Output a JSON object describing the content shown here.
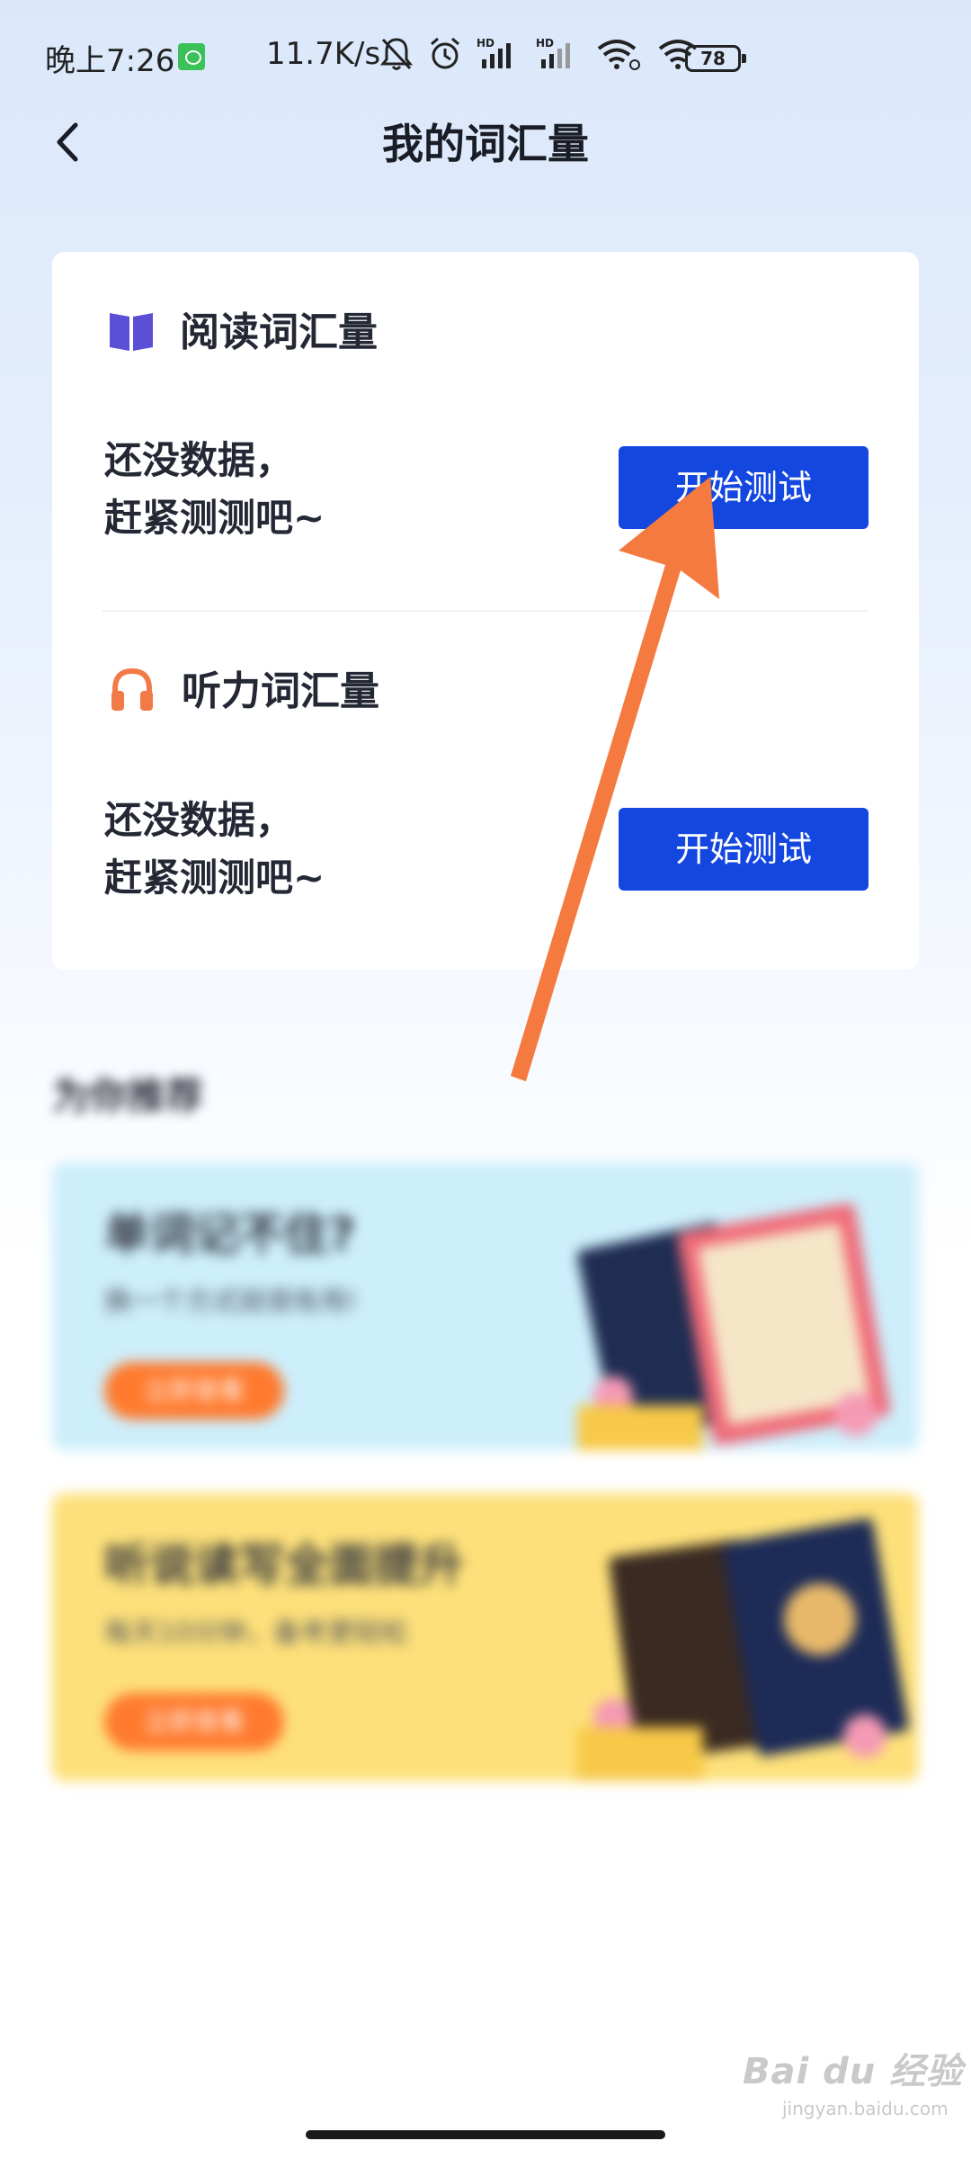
{
  "status_bar": {
    "time": "晚上7:26",
    "net_speed": "11.7K/s",
    "battery": "78",
    "icons": [
      "mute-bell-icon",
      "alarm-icon",
      "hd-signal-icon",
      "hd-signal-icon",
      "wifi-icon",
      "wifi-icon"
    ]
  },
  "header": {
    "title": "我的词汇量",
    "back_icon": "chevron-left-icon"
  },
  "vocab": {
    "reading": {
      "title": "阅读词汇量",
      "icon": "book-icon",
      "icon_color": "#5b4fd6",
      "empty_text": "还没数据，\n赶紧测测吧~",
      "button_label": "开始测试"
    },
    "listening": {
      "title": "听力词汇量",
      "icon": "headphones-icon",
      "icon_color": "#f27a47",
      "empty_text": "还没数据，\n赶紧测测吧~",
      "button_label": "开始测试"
    },
    "button_color": "#1447e0"
  },
  "recommend": {
    "heading": "为你推荐",
    "cards": [
      {
        "title": "单词记不住?",
        "subtitle": "换一个方式就很有用!",
        "button": "立即查看",
        "bg": "#cdeefb"
      },
      {
        "title": "听说读写全面提升",
        "subtitle": "每天10分钟，备考更轻松",
        "button": "立即查看",
        "bg": "#fde07a"
      }
    ]
  },
  "annotation": {
    "color": "#f47a3f"
  },
  "watermark": {
    "text": "Bai du 经验",
    "sub": "jingyan.baidu.com"
  }
}
